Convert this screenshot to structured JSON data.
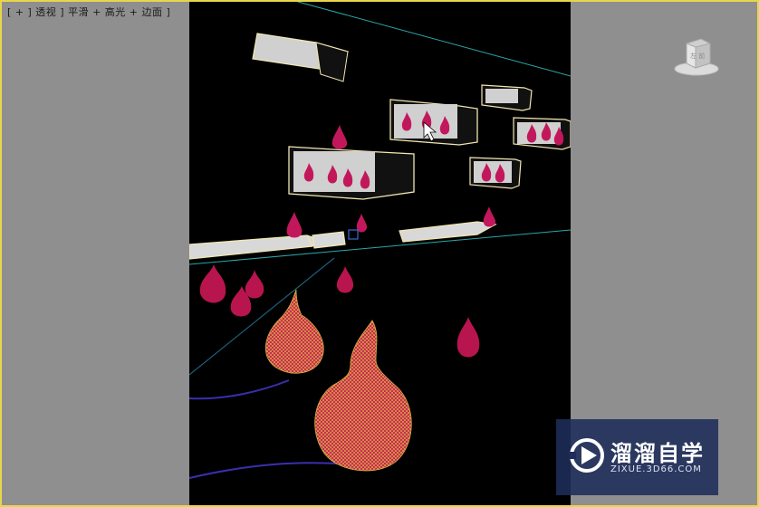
{
  "viewport": {
    "label": "[ + ] 透视 ] 平滑 + 高光 + 边面 ]"
  },
  "viewcube": {
    "face_label": "左  前",
    "icon": "viewcube-icon"
  },
  "watermark": {
    "title": "溜溜自学",
    "url": "ZIXUE.3D66.COM",
    "icon": "play-logo-icon"
  },
  "colors": {
    "viewport_border": "#e8d64a",
    "background": "#8f8f8f",
    "scene": "#000000",
    "selection": "#f2e6b0",
    "flame": "#c2185b",
    "guide_line": "#2aa7a7",
    "spline": "#3a2fb0"
  }
}
